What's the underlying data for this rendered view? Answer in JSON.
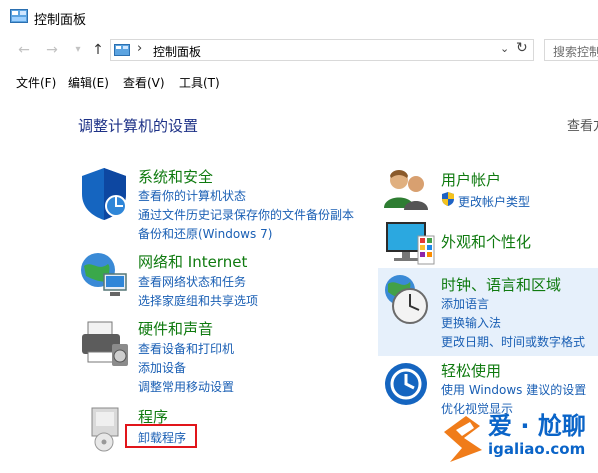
{
  "window": {
    "title": "控制面板"
  },
  "address": {
    "path": "控制面板",
    "separator": "›",
    "search_placeholder": "搜索控制"
  },
  "nav": {
    "back_icon": "arrow-left-icon",
    "forward_icon": "arrow-right-icon",
    "recent_icon": "chevron-down-icon",
    "up_icon": "arrow-up-icon"
  },
  "menu": [
    "文件(F)",
    "编辑(E)",
    "查看(V)",
    "工具(T)"
  ],
  "heading": "调整计算机的设置",
  "view_by": "查看方",
  "categories": {
    "security": {
      "title": "系统和安全",
      "links": [
        "查看你的计算机状态",
        "通过文件历史记录保存你的文件备份副本",
        "备份和还原(Windows 7)"
      ]
    },
    "network": {
      "title": "网络和 Internet",
      "links": [
        "查看网络状态和任务",
        "选择家庭组和共享选项"
      ]
    },
    "hardware": {
      "title": "硬件和声音",
      "links": [
        "查看设备和打印机",
        "添加设备",
        "调整常用移动设置"
      ]
    },
    "programs": {
      "title": "程序",
      "links": [
        "卸载程序"
      ]
    },
    "users": {
      "title": "用户帐户",
      "links": [
        "更改帐户类型"
      ]
    },
    "appearance": {
      "title": "外观和个性化",
      "links": []
    },
    "clock": {
      "title": "时钟、语言和区域",
      "links": [
        "添加语言",
        "更换输入法",
        "更改日期、时间或数字格式"
      ]
    },
    "ease": {
      "title": "轻松使用",
      "links": [
        "使用 Windows 建议的设置",
        "优化视觉显示"
      ]
    }
  },
  "watermark": {
    "line1": "爱 · 尬聊",
    "line2": "igaliao.com"
  },
  "colors": {
    "heading": "#1e3287",
    "category_title": "#0f7a0f",
    "link": "#1a5fb4",
    "highlight_bg": "#e6f0fb",
    "annotation_red": "#e1151a",
    "watermark_blue": "#0a64c8"
  }
}
